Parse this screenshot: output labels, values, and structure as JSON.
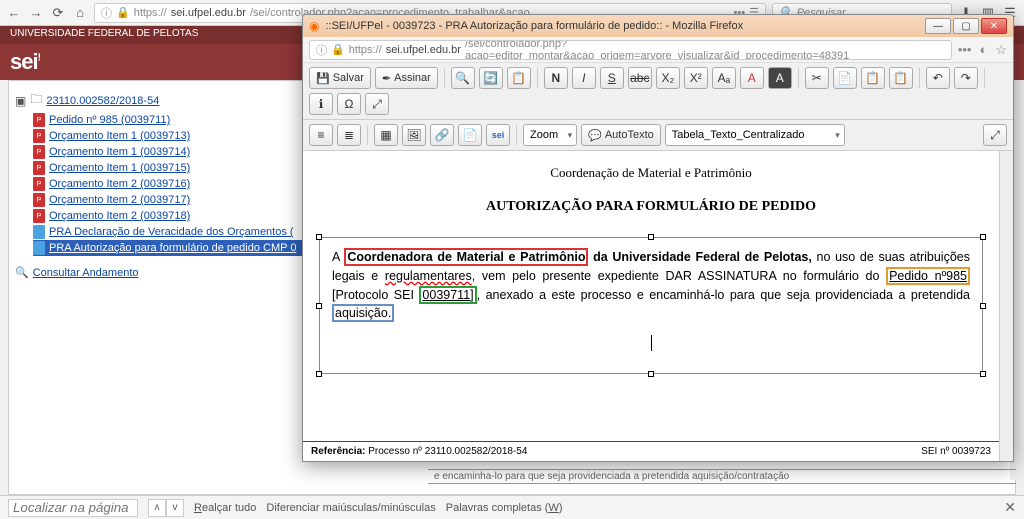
{
  "browser": {
    "url_prefix": "https://",
    "url_host": "sei.ufpel.edu.br",
    "url_path": "/sei/controlador.php?acao=procedimento_trabalhar&acao",
    "url_ellipsis": "•••",
    "search_placeholder": "Pesquisar"
  },
  "sei": {
    "university": "UNIVERSIDADE FEDERAL DE PELOTAS",
    "logo": "sei!"
  },
  "tree": {
    "process": "23110.002582/2018-54",
    "items": [
      "Pedido nº 985 (0039711)",
      "Orçamento Item 1 (0039713)",
      "Orçamento Item 1 (0039714)",
      "Orçamento Item 1 (0039715)",
      "Orçamento Item 2 (0039716)",
      "Orçamento Item 2 (0039717)",
      "Orçamento Item 2 (0039718)"
    ],
    "decl": "PRA Declaração de Veracidade dos Orçamentos (",
    "selected": "PRA Autorização para formulário de pedido CMP 0",
    "consult": "Consultar Andamento"
  },
  "popup": {
    "title": "::SEI/UFPel - 0039723 - PRA Autorização para formulário de pedido:: - Mozilla Firefox",
    "url_prefix": "https://",
    "url_host": "sei.ufpel.edu.br",
    "url_path": "/sei/controlador.php?acao=editor_montar&acao_origem=arvore_visualizar&id_procedimento=48391"
  },
  "toolbar": {
    "save": "Salvar",
    "sign": "Assinar",
    "zoom": "Zoom",
    "autotext": "AutoTexto",
    "style_select": "Tabela_Texto_Centralizado"
  },
  "doc": {
    "coord": "Coordenação de Material e Patrimônio",
    "title": "AUTORIZAÇÃO PARA FORMULÁRIO DE PEDIDO",
    "p_a": "A ",
    "p_coord": "Coordenadora de Material e Patrimônio",
    "p_da": " da Universidade Federal de Pelotas,",
    "p_uso": " no uso de suas atribuições legais e ",
    "p_reg": "regulamentares",
    "p_vem": ", vem pelo presente expediente DAR ASSINATURA no formulário do ",
    "p_pedido": "Pedido nº985",
    "p_prot": " [Protocolo SEI ",
    "p_protnum": "0039711]",
    "p_anex": ", anexado a este processo e encaminhá-lo para que seja providenciada a pretendida ",
    "p_aquis": "aquisição."
  },
  "ref": {
    "label": "Referência:",
    "proc": " Processo nº 23110.002582/2018-54",
    "sei": "SEI nº 0039723"
  },
  "hidden_strip": "e encaminha-lo para que seja providenciada a pretendida aquisição/contratação",
  "findbar": {
    "placeholder": "Localizar na página",
    "highlight": "Realçar tudo",
    "case": "Diferenciar maiúsculas/minúsculas",
    "whole": "Palavras completas (W)"
  }
}
